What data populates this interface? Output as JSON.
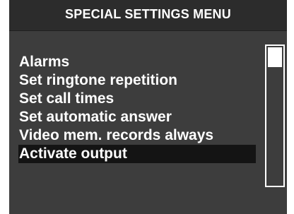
{
  "header": {
    "title": "SPECIAL SETTINGS MENU"
  },
  "menu": {
    "items": [
      {
        "label": "Alarms",
        "selected": false
      },
      {
        "label": "Set ringtone repetition",
        "selected": false
      },
      {
        "label": "Set call times",
        "selected": false
      },
      {
        "label": "Set automatic answer",
        "selected": false
      },
      {
        "label": "Video mem. records always",
        "selected": false
      },
      {
        "label": "Activate output",
        "selected": true
      }
    ]
  },
  "scrollbar": {
    "position_fraction": 0.0
  },
  "colors": {
    "panel_background": "#3d3d3d",
    "title_background": "#2c2c2c",
    "text": "#ffffff",
    "selection_background": "#141414"
  }
}
